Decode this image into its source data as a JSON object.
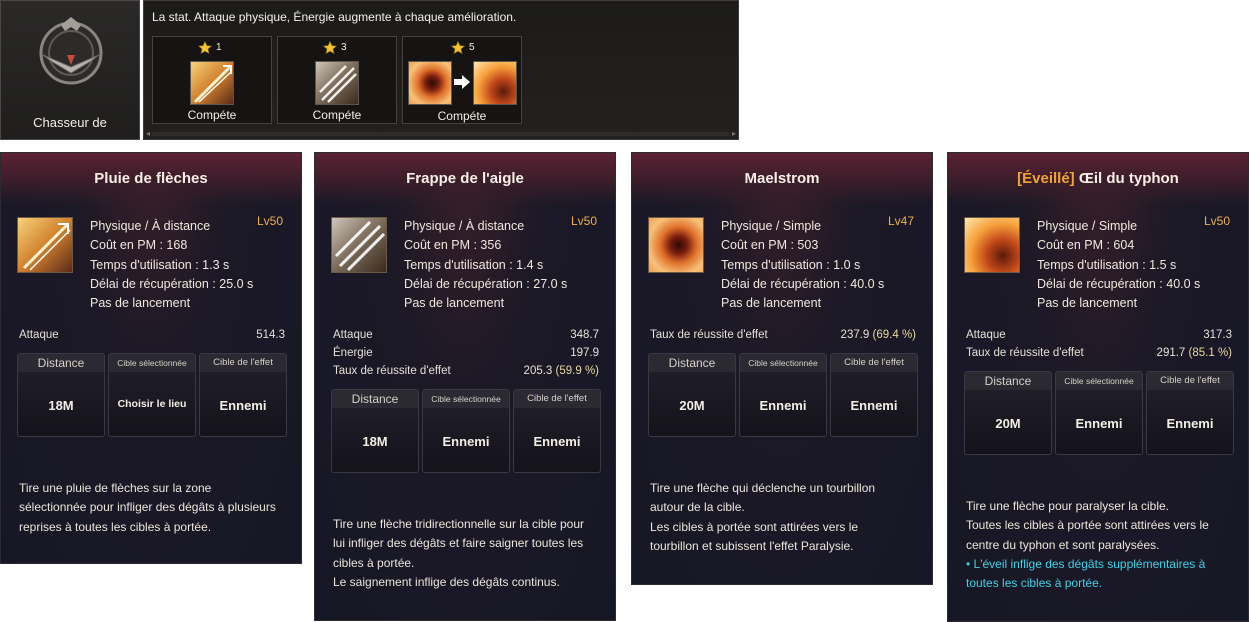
{
  "class_panel": {
    "class_name": "Chasseur de",
    "description": "La stat. Attaque physique, Énergie augmente à chaque amélioration.",
    "upgrades": [
      {
        "level": "1",
        "label": "Compéte"
      },
      {
        "level": "3",
        "label": "Compéte"
      },
      {
        "level": "5",
        "label": "Compéte"
      }
    ]
  },
  "colors": {
    "accent_gold": "#e8b24c",
    "awakened_orange": "#f2a433",
    "highlight_cyan": "#38d4e6",
    "star_yellow": "#f5c531"
  },
  "cards": [
    {
      "title": "Pluie de flèches",
      "level": "Lv50",
      "info": [
        "Physique / À distance",
        "Coût en PM : 168",
        "Temps d'utilisation : 1.3 s",
        "Délai de récupération : 25.0 s",
        "Pas de lancement"
      ],
      "stats": [
        {
          "label": "Attaque",
          "value": "514.3",
          "pct": ""
        }
      ],
      "targets": {
        "h1": "Distance",
        "v1": "18M",
        "h2": "Cible sélectionnée",
        "v2": "Choisir le lieu",
        "h3": "Cible de l'effet",
        "v3": "Ennemi"
      },
      "description": [
        "Tire une pluie de flèches sur la zone",
        "sélectionnée pour infliger des dégâts à plusieurs",
        "reprises à toutes les cibles à portée."
      ]
    },
    {
      "title": "Frappe de l'aigle",
      "level": "Lv50",
      "info": [
        "Physique / À distance",
        "Coût en PM : 356",
        "Temps d'utilisation : 1.4 s",
        "Délai de récupération : 27.0 s",
        "Pas de lancement"
      ],
      "stats": [
        {
          "label": "Attaque",
          "value": "348.7",
          "pct": ""
        },
        {
          "label": "Énergie",
          "value": "197.9",
          "pct": ""
        },
        {
          "label": "Taux de réussite d'effet",
          "value": "205.3",
          "pct": "(59.9 %)"
        }
      ],
      "targets": {
        "h1": "Distance",
        "v1": "18M",
        "h2": "Cible sélectionnée",
        "v2": "Ennemi",
        "h3": "Cible de l'effet",
        "v3": "Ennemi"
      },
      "description": [
        "Tire une flèche tridirectionnelle sur la cible pour",
        "lui infliger des dégâts et faire saigner toutes les",
        "cibles à portée.",
        "Le saignement inflige des dégâts continus."
      ]
    },
    {
      "title": "Maelstrom",
      "level": "Lv47",
      "info": [
        "Physique / Simple",
        "Coût en PM : 503",
        "Temps d'utilisation : 1.0 s",
        "Délai de récupération : 40.0 s",
        "Pas de lancement"
      ],
      "stats": [
        {
          "label": "Taux de réussite d'effet",
          "value": "237.9",
          "pct": "(69.4 %)"
        }
      ],
      "targets": {
        "h1": "Distance",
        "v1": "20M",
        "h2": "Cible sélectionnée",
        "v2": "Ennemi",
        "h3": "Cible de l'effet",
        "v3": "Ennemi"
      },
      "description": [
        "Tire une flèche qui déclenche un tourbillon",
        "autour de la cible.",
        "Les cibles à portée sont attirées vers le",
        "tourbillon et subissent l'effet Paralysie."
      ]
    },
    {
      "title_prefix": "[Éveillé]",
      "title": "Œil du typhon",
      "level": "Lv50",
      "info": [
        "Physique / Simple",
        "Coût en PM : 604",
        "Temps d'utilisation : 1.5 s",
        "Délai de récupération : 40.0 s",
        "Pas de lancement"
      ],
      "stats": [
        {
          "label": "Attaque",
          "value": "317.3",
          "pct": ""
        },
        {
          "label": "Taux de réussite d'effet",
          "value": "291.7",
          "pct": "(85.1 %)"
        }
      ],
      "targets": {
        "h1": "Distance",
        "v1": "20M",
        "h2": "Cible sélectionnée",
        "v2": "Ennemi",
        "h3": "Cible de l'effet",
        "v3": "Ennemi"
      },
      "description": [
        "Tire une flèche pour paralyser la cible.",
        "Toutes les cibles à portée sont attirées vers le",
        "centre du typhon et sont paralysées."
      ],
      "highlight": [
        "• L'éveil inflige des dégâts supplémentaires à",
        "toutes les cibles à portée."
      ]
    }
  ]
}
